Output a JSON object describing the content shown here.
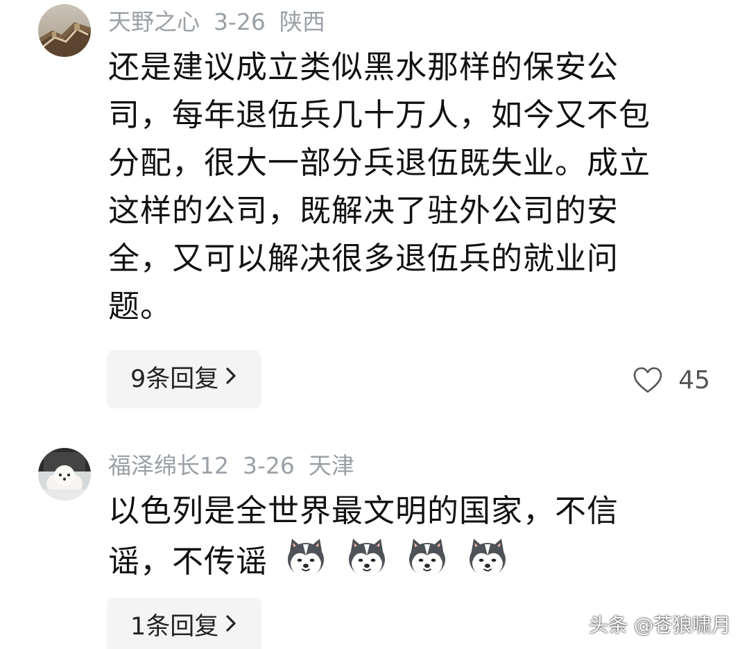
{
  "comments": [
    {
      "username": "天野之心",
      "date": "3-26",
      "location": "陕西",
      "lines": [
        "还是建议成立类似黑水那样的保安公",
        "司，每年退伍兵几十万人，如今又不包",
        "分配，很大一部分兵退伍既失业。成立",
        "这样的公司，既解决了驻外公司的安",
        "全，又可以解决很多退伍兵的就业问",
        "题。"
      ],
      "reply_label": "9条回复",
      "like_count": "45",
      "avatar_icon": "great-wall-photo-avatar"
    },
    {
      "username": "福泽绵长12",
      "date": "3-26",
      "location": "天津",
      "lines": [
        "以色列是全世界最文明的国家，不信",
        "谣，不传谣"
      ],
      "emoji_icon": "husky-dog-emoji",
      "emoji_count": 4,
      "reply_label": "1条回复",
      "avatar_icon": "white-dog-photo-avatar"
    }
  ],
  "watermark": "头条 @苍狼啸月",
  "colors": {
    "meta_text": "#9aa0a6",
    "body_text": "#111111",
    "reply_bg": "#f4f4f5"
  },
  "icons": [
    "chevron-right-icon",
    "heart-outline-icon"
  ]
}
